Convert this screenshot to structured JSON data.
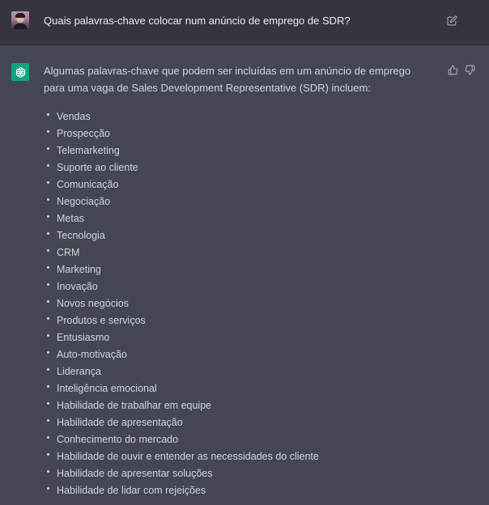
{
  "user_message": {
    "text": "Quais palavras-chave colocar num anúncio de emprego de SDR?"
  },
  "assistant_message": {
    "intro": "Algumas palavras-chave que podem ser incluídas em um anúncio de emprego para uma vaga de Sales Development Representative (SDR) incluem:",
    "keywords": [
      "Vendas",
      "Prospecção",
      "Telemarketing",
      "Suporte ao cliente",
      "Comunicação",
      "Negociação",
      "Metas",
      "Tecnologia",
      "CRM",
      "Marketing",
      "Inovação",
      "Novos negócios",
      "Produtos e serviços",
      "Entusiasmo",
      "Auto-motivação",
      "Liderança",
      "Inteligência emocional",
      "Habilidade de trabalhar em equipe",
      "Habilidade de apresentação",
      "Conhecimento do mercado",
      "Habilidade de ouvir e entender as necessidades do cliente",
      "Habilidade de apresentar soluções",
      "Habilidade de lidar com rejeições"
    ]
  },
  "icons": {
    "user_avatar": "user-avatar",
    "assistant_avatar": "openai-logo-icon",
    "edit": "edit-icon",
    "like": "thumbs-up-icon",
    "dislike": "thumbs-down-icon"
  },
  "colors": {
    "user_bg": "#343541",
    "assistant_bg": "#444654",
    "accent": "#10a37f",
    "text": "#d1d5db"
  }
}
